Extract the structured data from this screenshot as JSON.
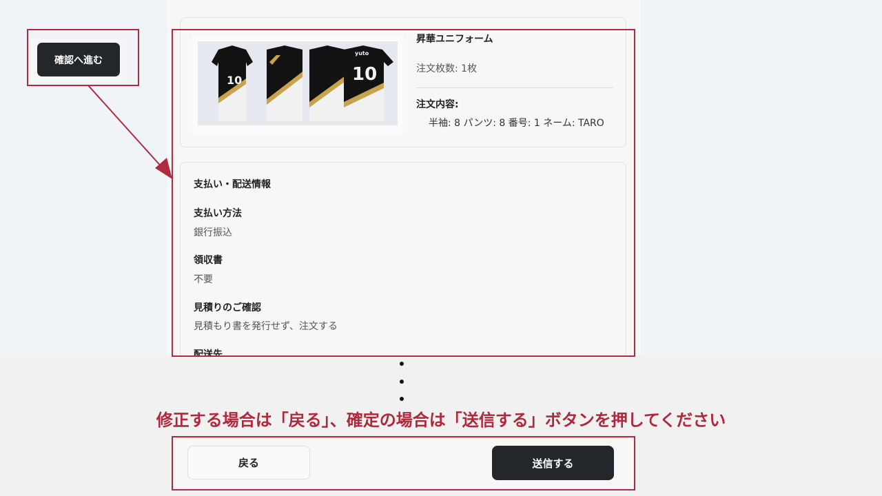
{
  "product": {
    "name": "昇華ユニフォーム",
    "quantity": "注文枚数: 1枚",
    "detail_label": "注文内容:",
    "detail_value": "半袖: 8 パンツ: 8 番号: 1 ネーム: TARO",
    "image": {
      "jersey_text": "yuto",
      "number": "10",
      "colors": [
        "#111111",
        "#f2f2f2",
        "#c8a24c"
      ]
    }
  },
  "payment": {
    "title": "支払い・配送情報",
    "method_label": "支払い方法",
    "method_value": "銀行振込",
    "receipt_label": "領収書",
    "receipt_value": "不要",
    "estimate_label": "見積りのご確認",
    "estimate_value": "見積もり書を発行せず、注文する",
    "shipping_label": "配送先"
  },
  "floating": {
    "confirm_label": "確認へ進む"
  },
  "instruction": {
    "text": "修正する場合は「戻る」、確定の場合は「送信する」ボタンを押してください",
    "color": "#b0283b"
  },
  "actions": {
    "back_label": "戻る",
    "send_label": "送信する"
  },
  "accent": {
    "annotation_red": "#b22a3d",
    "button_dark": "#23272b"
  }
}
